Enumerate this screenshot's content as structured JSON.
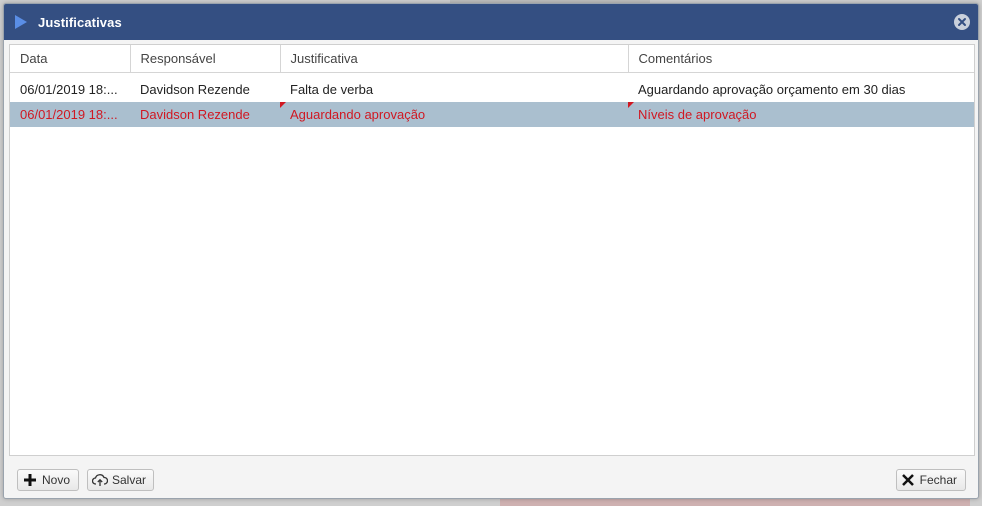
{
  "dialog": {
    "title": "Justificativas"
  },
  "table": {
    "columns": [
      "Data",
      "Responsável",
      "Justificativa",
      "Comentários"
    ],
    "rows": [
      {
        "data": "06/01/2019 18:...",
        "responsavel": "Davidson Rezende",
        "justificativa": "Falta de verba",
        "comentarios": "Aguardando aprovação orçamento em 30 dias"
      },
      {
        "data": "06/01/2019 18:...",
        "responsavel": "Davidson Rezende",
        "justificativa": "Aguardando aprovação",
        "comentarios": "Níveis de aprovação"
      }
    ]
  },
  "footer": {
    "novo_label": "Novo",
    "salvar_label": "Salvar",
    "fechar_label": "Fechar"
  },
  "colors": {
    "titlebar": "#344f82",
    "selected_row": "#aabfcf",
    "dirty_text": "#d01822"
  },
  "icons": {
    "title": "play-arrow-icon",
    "close": "close-circle-icon",
    "novo": "plus-icon",
    "salvar": "cloud-upload-icon",
    "fechar": "x-icon"
  }
}
